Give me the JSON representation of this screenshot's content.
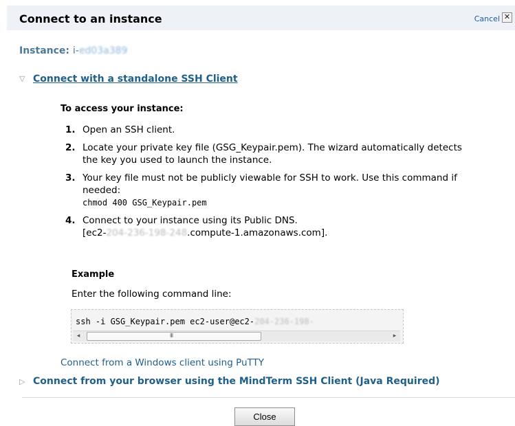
{
  "dialog": {
    "title": "Connect to an instance",
    "cancel_label": "Cancel",
    "close_x": "✕"
  },
  "instance": {
    "label": "Instance:",
    "id_prefix": "i-",
    "id_masked": "ed03a389"
  },
  "sections": {
    "ssh": {
      "expanded_icon": "▽",
      "label": "Connect with a standalone SSH Client"
    },
    "mindterm": {
      "collapsed_icon": "▷",
      "label": "Connect from your browser using the MindTerm SSH Client (Java Required)"
    }
  },
  "access": {
    "heading": "To access your instance:",
    "steps": [
      {
        "num": "1.",
        "text": "Open an SSH client."
      },
      {
        "num": "2.",
        "text": "Locate your private key file (GSG_Keypair.pem). The wizard automatically detects the key you used to launch the instance."
      },
      {
        "num": "3.",
        "text": "Your key file must not be publicly viewable for SSH to work. Use this command if needed:",
        "code": "chmod 400 GSG_Keypair.pem"
      },
      {
        "num": "4.",
        "text": "Connect to your instance using its Public DNS.",
        "dns_prefix": "[ec2-",
        "dns_masked": "204-236-198-248",
        "dns_suffix": ".compute-1.amazonaws.com]."
      }
    ]
  },
  "example": {
    "heading": "Example",
    "text": "Enter the following command line:",
    "command_prefix": "ssh -i GSG_Keypair.pem ec2-user@ec2-",
    "command_masked": "204-236-198-"
  },
  "scrollbar": {
    "left_arrow": "◂",
    "right_arrow": "▸",
    "grip": "III"
  },
  "putty_link": "Connect from a Windows client using PuTTY",
  "close_label": "Close"
}
